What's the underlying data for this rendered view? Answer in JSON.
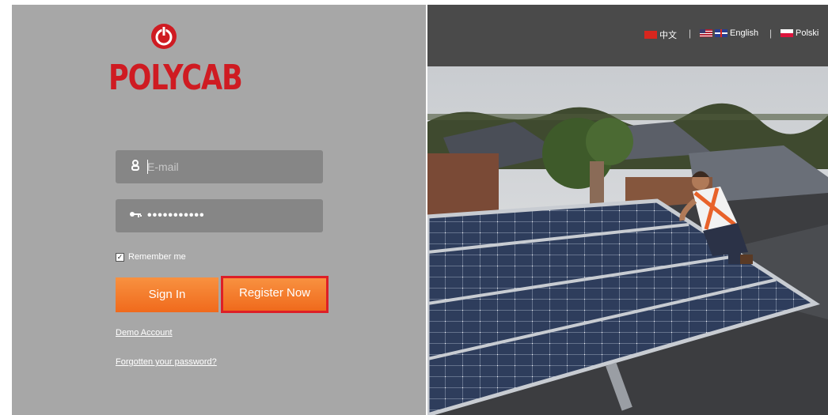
{
  "brand": {
    "name": "POLYCAB"
  },
  "login": {
    "email_placeholder": "E-mail",
    "password_mask": "•••••••••••",
    "remember_label": "Remember me",
    "remember_checked": true,
    "signin_label": "Sign In",
    "register_label": "Register Now",
    "demo_label": "Demo Account",
    "forgot_label": "Forgotten your password?"
  },
  "languages": [
    {
      "label": "中文",
      "icon": "china-flag-icon"
    },
    {
      "label": "English",
      "icon": "us-uk-flag-icon"
    },
    {
      "label": "Polski",
      "icon": "poland-flag-icon"
    }
  ],
  "colors": {
    "panel_bg": "#a7a7a7",
    "field_bg": "#868686",
    "brand_red": "#cf1b22",
    "button_orange": "#f37a2a",
    "highlight_red": "#dd1f27",
    "lang_bar_bg": "#4a4a4a"
  },
  "icons": {
    "power": "power-logo-icon",
    "user": "user-icon",
    "key": "key-icon",
    "checkbox": "checkbox-icon"
  }
}
